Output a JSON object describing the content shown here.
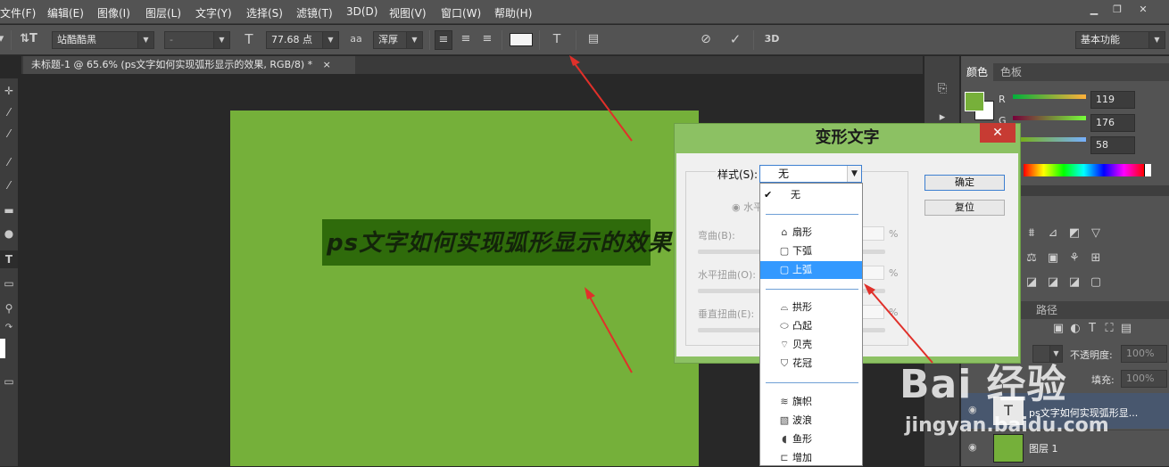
{
  "menu": [
    "文件(F)",
    "编辑(E)",
    "图像(I)",
    "图层(L)",
    "文字(Y)",
    "选择(S)",
    "滤镜(T)",
    "3D(D)",
    "视图(V)",
    "窗口(W)",
    "帮助(H)"
  ],
  "options": {
    "font_family": "站酷酷黑",
    "font_style": "-",
    "font_size": "77.68 点",
    "aa_label": "aa",
    "antialias": "浑厚",
    "cancel_icon": "cancel-icon",
    "commit_icon": "check-icon",
    "threed": "3D",
    "workspace": "基本功能"
  },
  "document": {
    "tab_title": "未标题-1 @ 65.6% (ps文字如何实现弧形显示的效果, RGB/8) *",
    "close": "×",
    "canvas_color": "#75b03a",
    "text": "ps文字如何实现弧形显示的效果"
  },
  "color_panel": {
    "tabs": [
      "颜色",
      "色板"
    ],
    "r_label": "R",
    "g_label": "G",
    "b_label": "B",
    "r": "119",
    "g": "176",
    "b": "58",
    "fg_color": "#77b03a"
  },
  "layers_panel": {
    "tab_paths": "路径",
    "opacity_label": "不透明度:",
    "opacity": "100%",
    "fill_label": "填充:",
    "fill": "100%",
    "layers": [
      {
        "name": "ps文字如何实现弧形显...",
        "thumb": "T"
      },
      {
        "name": "图层 1",
        "thumb": ""
      }
    ]
  },
  "warp_dialog": {
    "title": "变形文字",
    "style_label": "样式(S):",
    "style_value": "无",
    "horizontal": "水平",
    "bend_label": "弯曲(B):",
    "hdistort_label": "水平扭曲(O):",
    "vdistort_label": "垂直扭曲(E):",
    "percent": "%",
    "ok": "确定",
    "reset": "复位",
    "close": "✕"
  },
  "dropdown": {
    "none": "无",
    "group1": [
      "扇形",
      "下弧",
      "上弧"
    ],
    "group2": [
      "拱形",
      "凸起",
      "贝壳",
      "花冠"
    ],
    "group3": [
      "旗帜",
      "波浪",
      "鱼形",
      "增加"
    ],
    "selected": "上弧"
  },
  "watermark": {
    "brand": "Bai 经验",
    "url": "jingyan.baidu.com"
  }
}
